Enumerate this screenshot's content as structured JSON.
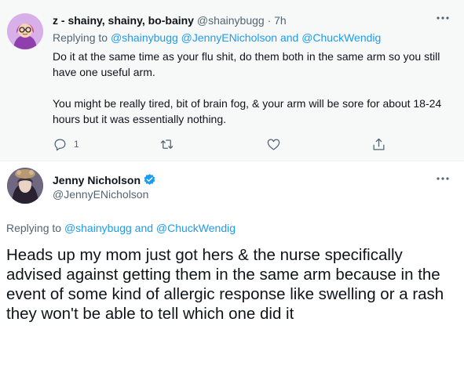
{
  "reply_tweet": {
    "name": "z - shainy, shainy, bo-bainy",
    "handle": "@shainybugg",
    "separator": "·",
    "time": "7h",
    "replying_prefix": "Replying to",
    "replying_users": [
      "@shainybugg",
      "@JennyENicholson",
      "@ChuckWendig"
    ],
    "replying_and": "and",
    "paragraphs": [
      "Do it at the same time as your flu shit, do them both in the same arm so you still have one useful arm.",
      "You might be really tired, bit of brain fog, & your arm will be sore for about 18-24 hours but it was essentially nothing."
    ],
    "reply_count": "1",
    "more_icon": "more-dots-icon"
  },
  "main_tweet": {
    "name": "Jenny Nicholson",
    "handle": "@JennyENicholson",
    "replying_prefix": "Replying to",
    "replying_users": [
      "@shainybugg",
      "@ChuckWendig"
    ],
    "replying_and": "and",
    "text": "Heads up my mom just got hers & the nurse specifically advised against getting them in the same arm because in the event of some kind of allergic response like swelling or a rash they won't be able to tell which one did it",
    "verified_icon": "verified-badge-icon"
  },
  "colors": {
    "link": "#1d9bf0",
    "muted": "#536471",
    "text": "#0f1419",
    "reply_background": "#f7f9f9"
  }
}
